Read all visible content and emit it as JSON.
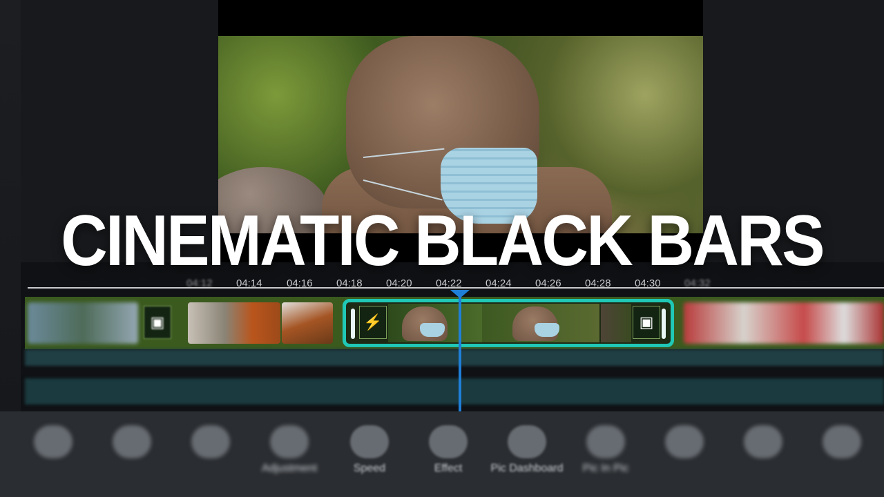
{
  "overlay": {
    "title": "CINEMATIC BLACK BARS"
  },
  "timeline": {
    "ticks": [
      "04:12",
      "04:14",
      "04:16",
      "04:18",
      "04:20",
      "04:22",
      "04:24",
      "04:26",
      "04:28",
      "04:30",
      "04:32"
    ],
    "playhead_time": "04:22",
    "accent_color": "#20c8b6",
    "playhead_color": "#1f7fd8"
  },
  "toolbar": {
    "items": [
      {
        "label": "",
        "icon": "tool-icon"
      },
      {
        "label": "",
        "icon": "tool-icon"
      },
      {
        "label": "",
        "icon": "tool-icon"
      },
      {
        "label": "Adjustment",
        "icon": "adjust-icon"
      },
      {
        "label": "Speed",
        "icon": "speed-icon"
      },
      {
        "label": "Effect",
        "icon": "effect-icon"
      },
      {
        "label": "Pic Dashboard",
        "icon": "pic-icon"
      },
      {
        "label": "Pic In Pic",
        "icon": "pip-icon"
      },
      {
        "label": "",
        "icon": "tool-icon"
      },
      {
        "label": "",
        "icon": "tool-icon"
      },
      {
        "label": "",
        "icon": "tool-icon"
      }
    ]
  }
}
